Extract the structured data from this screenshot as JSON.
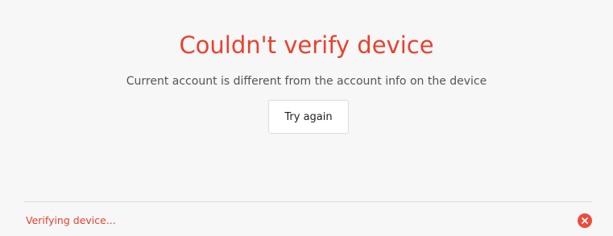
{
  "dialog": {
    "title": "Couldn't verify device",
    "message": "Current account is different from the account info on the device",
    "try_again_label": "Try again"
  },
  "status": {
    "text": "Verifying device...",
    "close_icon": "close-icon"
  },
  "colors": {
    "error": "#e8412f",
    "background": "#f7f7f7",
    "message_text": "#555555",
    "close_button": "#ee4b3e"
  }
}
